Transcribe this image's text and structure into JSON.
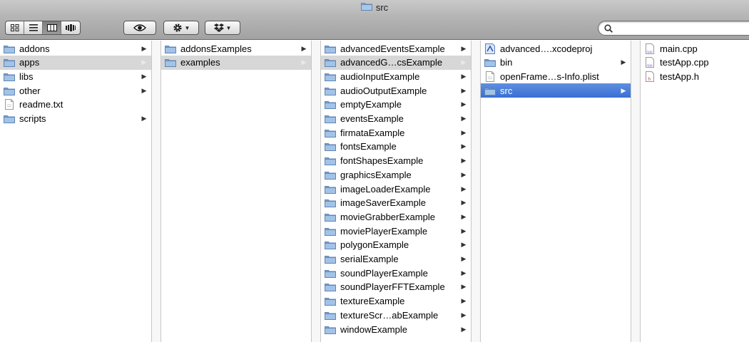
{
  "window": {
    "title": "src",
    "title_icon": "folder-icon"
  },
  "toolbar": {
    "view_buttons": [
      {
        "name": "icon-view",
        "icon": "grid-icon",
        "active": false
      },
      {
        "name": "list-view",
        "icon": "list-icon",
        "active": false
      },
      {
        "name": "column-view",
        "icon": "columns-icon",
        "active": true
      },
      {
        "name": "coverflow-view",
        "icon": "coverflow-icon",
        "active": false
      }
    ],
    "quicklook_icon": "eye-icon",
    "action_icon": "gear-icon",
    "dropbox_icon": "dropbox-icon",
    "search_placeholder": ""
  },
  "colors": {
    "folder": "#8db3dc",
    "selection_blue": "#3a6fd3",
    "selection_gray": "#d7d7d7"
  },
  "columns": [
    {
      "items": [
        {
          "label": "addons",
          "kind": "folder",
          "arrow": true,
          "selected": ""
        },
        {
          "label": "apps",
          "kind": "folder",
          "arrow": true,
          "selected": "gray"
        },
        {
          "label": "libs",
          "kind": "folder",
          "arrow": true,
          "selected": ""
        },
        {
          "label": "other",
          "kind": "folder",
          "arrow": true,
          "selected": ""
        },
        {
          "label": "readme.txt",
          "kind": "file",
          "arrow": false,
          "selected": ""
        },
        {
          "label": "scripts",
          "kind": "folder",
          "arrow": true,
          "selected": ""
        }
      ]
    },
    {
      "items": [
        {
          "label": "addonsExamples",
          "kind": "folder",
          "arrow": true,
          "selected": ""
        },
        {
          "label": "examples",
          "kind": "folder",
          "arrow": true,
          "selected": "gray"
        }
      ]
    },
    {
      "items": [
        {
          "label": "advancedEventsExample",
          "kind": "folder",
          "arrow": true,
          "selected": ""
        },
        {
          "label": "advancedG…csExample",
          "kind": "folder",
          "arrow": true,
          "selected": "gray"
        },
        {
          "label": "audioInputExample",
          "kind": "folder",
          "arrow": true,
          "selected": ""
        },
        {
          "label": "audioOutputExample",
          "kind": "folder",
          "arrow": true,
          "selected": ""
        },
        {
          "label": "emptyExample",
          "kind": "folder",
          "arrow": true,
          "selected": ""
        },
        {
          "label": "eventsExample",
          "kind": "folder",
          "arrow": true,
          "selected": ""
        },
        {
          "label": "firmataExample",
          "kind": "folder",
          "arrow": true,
          "selected": ""
        },
        {
          "label": "fontsExample",
          "kind": "folder",
          "arrow": true,
          "selected": ""
        },
        {
          "label": "fontShapesExample",
          "kind": "folder",
          "arrow": true,
          "selected": ""
        },
        {
          "label": "graphicsExample",
          "kind": "folder",
          "arrow": true,
          "selected": ""
        },
        {
          "label": "imageLoaderExample",
          "kind": "folder",
          "arrow": true,
          "selected": ""
        },
        {
          "label": "imageSaverExample",
          "kind": "folder",
          "arrow": true,
          "selected": ""
        },
        {
          "label": "movieGrabberExample",
          "kind": "folder",
          "arrow": true,
          "selected": ""
        },
        {
          "label": "moviePlayerExample",
          "kind": "folder",
          "arrow": true,
          "selected": ""
        },
        {
          "label": "polygonExample",
          "kind": "folder",
          "arrow": true,
          "selected": ""
        },
        {
          "label": "serialExample",
          "kind": "folder",
          "arrow": true,
          "selected": ""
        },
        {
          "label": "soundPlayerExample",
          "kind": "folder",
          "arrow": true,
          "selected": ""
        },
        {
          "label": "soundPlayerFFTExample",
          "kind": "folder",
          "arrow": true,
          "selected": ""
        },
        {
          "label": "textureExample",
          "kind": "folder",
          "arrow": true,
          "selected": ""
        },
        {
          "label": "textureScr…abExample",
          "kind": "folder",
          "arrow": true,
          "selected": ""
        },
        {
          "label": "windowExample",
          "kind": "folder",
          "arrow": true,
          "selected": ""
        }
      ]
    },
    {
      "items": [
        {
          "label": "advanced….xcodeproj",
          "kind": "xcodeproj",
          "arrow": false,
          "selected": ""
        },
        {
          "label": "bin",
          "kind": "folder",
          "arrow": true,
          "selected": ""
        },
        {
          "label": "openFrame…s-Info.plist",
          "kind": "file",
          "arrow": false,
          "selected": ""
        },
        {
          "label": "src",
          "kind": "folder",
          "arrow": true,
          "selected": "blue"
        }
      ]
    },
    {
      "items": [
        {
          "label": "main.cpp",
          "kind": "cpp",
          "arrow": false,
          "selected": ""
        },
        {
          "label": "testApp.cpp",
          "kind": "cpp",
          "arrow": false,
          "selected": ""
        },
        {
          "label": "testApp.h",
          "kind": "header",
          "arrow": false,
          "selected": ""
        }
      ]
    }
  ]
}
